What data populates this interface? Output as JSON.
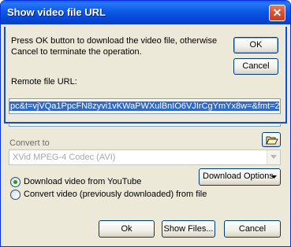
{
  "dialog": {
    "title": "Show video file URL",
    "close_glyph": "✕",
    "prompt": "Press OK button to download the video file, otherwise Cancel to terminate the operation.",
    "ok_label": "OK",
    "cancel_label": "Cancel",
    "remote_label": "Remote file URL:",
    "remote_url": "pc&t=vjVQa1PpcFN8zyvi1vKWaPWXulBnIO6VJIrCgYmYx8w=&fmt=22"
  },
  "main": {
    "convert_label": "Convert to",
    "folder_icon": "folder-open-icon",
    "codec_value": "XVid MPEG-4 Codec (AVI)",
    "download_options_label": "Download Options",
    "radio_options": [
      {
        "label": "Download video from YouTube",
        "checked": true
      },
      {
        "label": "Convert video (previously downloaded) from file",
        "checked": false
      }
    ],
    "buttons": {
      "ok": "Ok",
      "show_files": "Show Files...",
      "cancel": "Cancel"
    }
  },
  "colors": {
    "titlebar": "#0b5ae6",
    "selection": "#316ac5",
    "window_bg": "#ece9d8",
    "radio_dot": "#21a121"
  }
}
